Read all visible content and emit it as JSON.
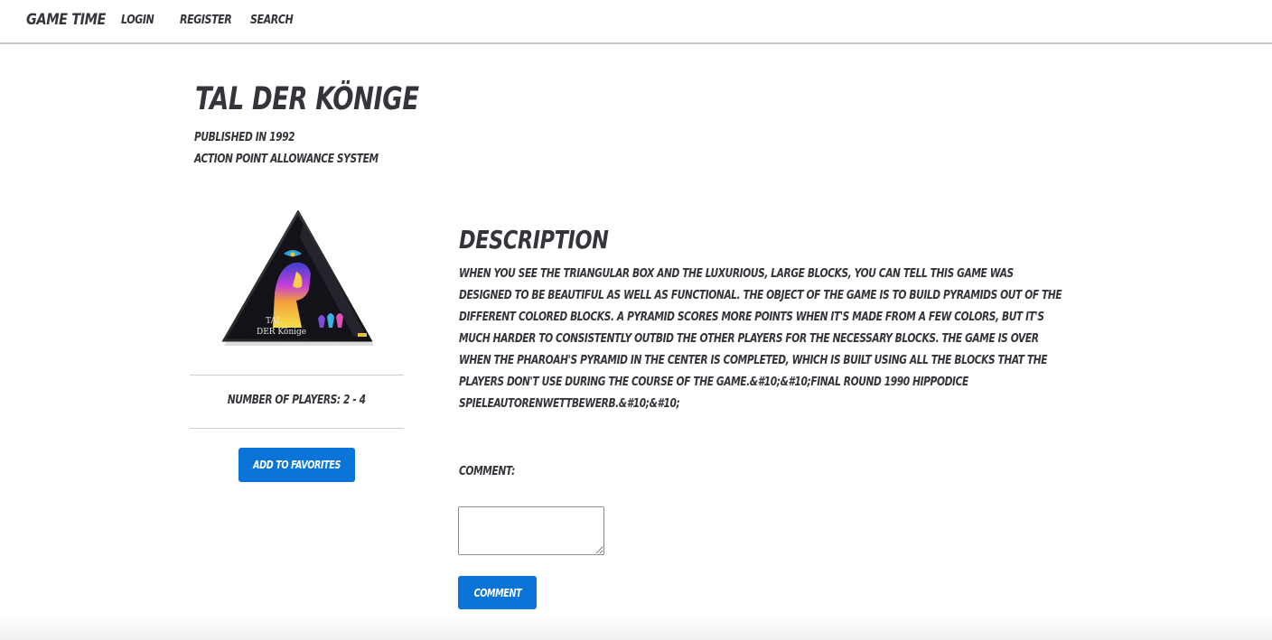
{
  "navbar": {
    "brand": "Game Time",
    "links": [
      "Login",
      "Register",
      "Search"
    ]
  },
  "game": {
    "title": "Tal der Könige",
    "published": "Published in 1992",
    "mechanic": "Action Point Allowance System",
    "cover_text_line1": "TAL",
    "cover_text_line2": "DER Könige",
    "players": "Number of Players: 2 - 4",
    "favorite_button": "Add to Favorites"
  },
  "description": {
    "heading": "Description",
    "body": "When you see the triangular box and the luxurious, large blocks, you can tell this game was designed to be beautiful as well as functional. The object of the game is to build pyramids out of the different colored blocks. A pyramid scores more points when it's made from a few colors, but it's much harder to consistently outbid the other players for the necessary blocks. The game is over when the Pharoah's pyramid in the center is completed, which is built using all the blocks that the players don't use during the course of the game.&#10;&#10;Final Round 1990 Hippodice Spieleautorenwettbewerb.&#10;&#10;"
  },
  "comments": {
    "label": "Comment:",
    "input_value": "",
    "submit_label": "Comment"
  },
  "colors": {
    "text": "#33353a",
    "button": "#0b74d8",
    "button_text": "#ffffff",
    "divider": "#cfcfcf"
  },
  "icons": {
    "cover": "game-box-cover"
  }
}
